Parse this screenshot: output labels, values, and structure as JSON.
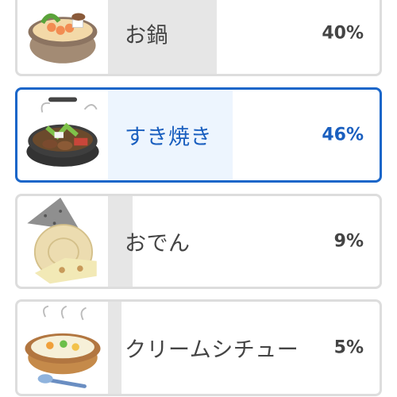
{
  "poll": {
    "options": [
      {
        "label": "お鍋",
        "percent_text": "40%",
        "percent": 40,
        "selected": false,
        "image": "hot-pot-icon"
      },
      {
        "label": "すき焼き",
        "percent_text": "46%",
        "percent": 46,
        "selected": true,
        "image": "sukiyaki-icon"
      },
      {
        "label": "おでん",
        "percent_text": "9%",
        "percent": 9,
        "selected": false,
        "image": "oden-icon"
      },
      {
        "label": "クリームシチュー",
        "percent_text": "5%",
        "percent": 5,
        "selected": false,
        "image": "cream-stew-icon"
      }
    ]
  },
  "colors": {
    "selected_border": "#1a66c9",
    "selected_text": "#1a5fbf",
    "bar_default": "#e6e6e6",
    "bar_selected": "#edf5fe",
    "text": "#444444"
  }
}
